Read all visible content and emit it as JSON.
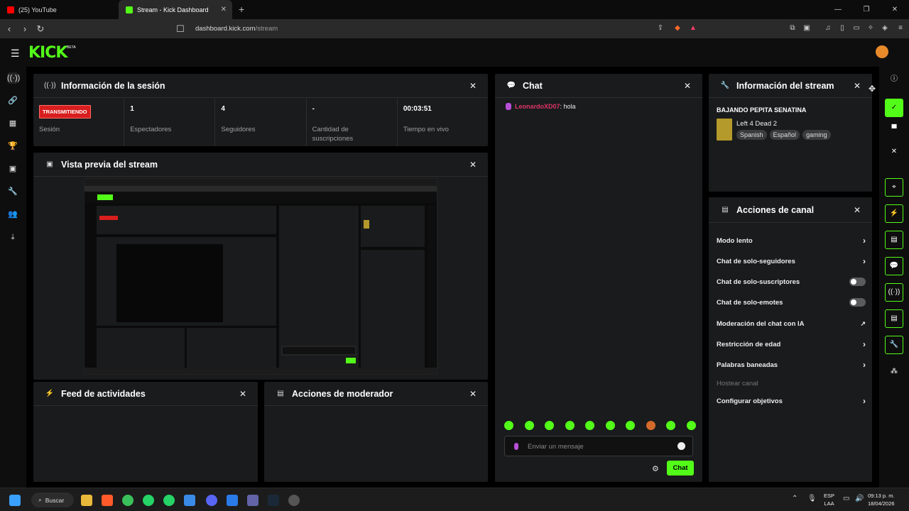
{
  "browser": {
    "tabs": [
      {
        "title": "(25) YouTube",
        "favicon_color": "#ff0000"
      },
      {
        "title": "Stream - Kick Dashboard",
        "favicon_color": "#53fc18"
      }
    ],
    "url_domain": "dashboard.kick.com",
    "url_path": "/stream"
  },
  "brand": {
    "logo": "KICK",
    "badge": "BETA",
    "accent": "#53fc18"
  },
  "session": {
    "title": "Información de la sesión",
    "live_badge": "TRANSMITIENDO",
    "stats": [
      {
        "value": "",
        "label": "Sesión"
      },
      {
        "value": "1",
        "label": "Espectadores"
      },
      {
        "value": "4",
        "label": "Seguidores"
      },
      {
        "value": "-",
        "label": "Cantidad de suscripciones"
      },
      {
        "value": "00:03:51",
        "label": "Tiempo en vivo"
      }
    ]
  },
  "preview": {
    "title": "Vista previa del stream"
  },
  "activity_feed": {
    "title": "Feed de actividades"
  },
  "mod_actions": {
    "title": "Acciones de moderador"
  },
  "chat": {
    "title": "Chat",
    "messages": [
      {
        "user": "LeonardoXD07",
        "text": ": hola"
      }
    ],
    "input_placeholder": "Enviar un mensaje",
    "send_label": "Chat"
  },
  "stream_info": {
    "title": "Información del stream",
    "stream_title": "BAJANDO PEPITA SENATINA",
    "game": "Left 4 Dead 2",
    "tags": [
      "Spanish",
      "Español",
      "gaming"
    ]
  },
  "channel_actions": {
    "title": "Acciones de canal",
    "items": [
      {
        "label": "Modo lento",
        "control": "chevron"
      },
      {
        "label": "Chat de solo-seguidores",
        "control": "chevron"
      },
      {
        "label": "Chat de solo-suscriptores",
        "control": "toggle"
      },
      {
        "label": "Chat de solo-emotes",
        "control": "toggle"
      },
      {
        "label": "Moderación del chat con IA",
        "control": "external"
      },
      {
        "label": "Restricción de edad",
        "control": "chevron"
      },
      {
        "label": "Palabras baneadas",
        "control": "chevron"
      },
      {
        "label": "Hostear canal",
        "control": "none"
      },
      {
        "label": "Configurar objetivos",
        "control": "chevron"
      }
    ]
  },
  "taskbar": {
    "search_label": "Buscar",
    "lang_top": "ESP",
    "lang_bottom": "LAA",
    "time": "09:13 p. m.",
    "date": "18/04/2026"
  }
}
